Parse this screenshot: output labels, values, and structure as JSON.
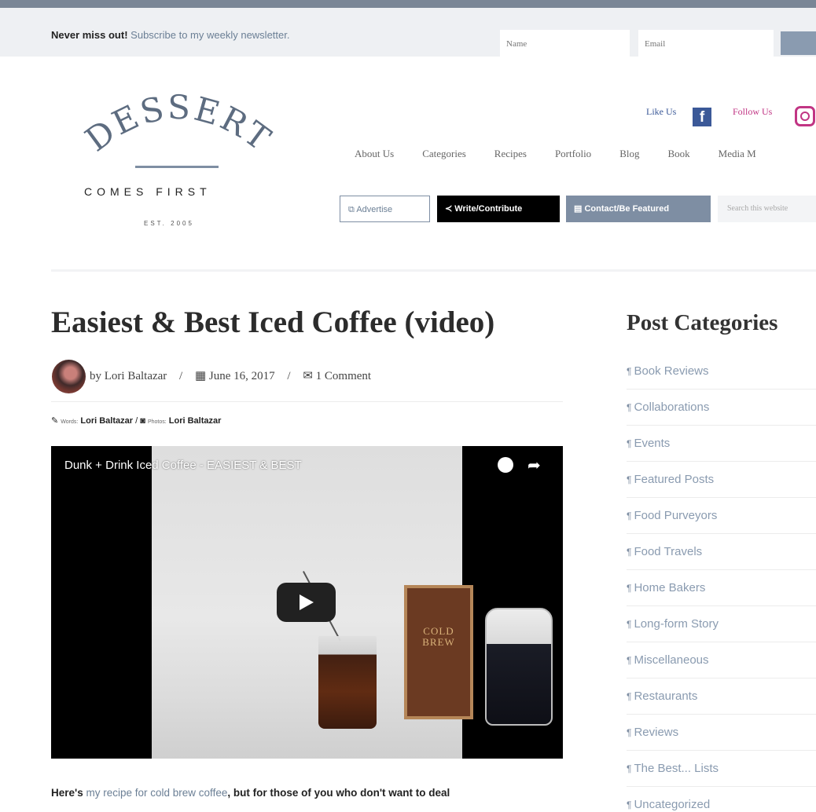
{
  "newsletter": {
    "lead": "Never miss out!",
    "cta": "Subscribe to my weekly newsletter.",
    "name_placeholder": "Name",
    "email_placeholder": "Email"
  },
  "logo": {
    "word": "DESSERT",
    "tagline": "COMES FIRST",
    "est": "EST. 2005"
  },
  "social": {
    "like_label": "Like Us",
    "follow_label": "Follow Us"
  },
  "nav": {
    "items": [
      "About Us",
      "Categories",
      "Recipes",
      "Portfolio",
      "Blog",
      "Book",
      "Media M"
    ]
  },
  "actions": {
    "advertise": "Advertise",
    "write": "Write/Contribute",
    "contact": "Contact/Be Featured",
    "search_placeholder": "Search this website"
  },
  "post": {
    "title": "Easiest & Best Iced Coffee (video)",
    "author": "by Lori Baltazar",
    "date": "June 16, 2017",
    "comments": "1 Comment",
    "words_label": "Words:",
    "words_author": "Lori Baltazar",
    "photos_label": "Photos:",
    "photos_author": "Lori Baltazar",
    "video_title": "Dunk + Drink Iced Coffee - EASIEST & BEST",
    "package_label_1": "COLD",
    "package_label_2": "BREW",
    "para_start": "Here's ",
    "para_link": "my recipe for cold brew coffee",
    "para_rest": ", but for those of you who don't want to deal"
  },
  "sidebar": {
    "title": "Post Categories",
    "categories": [
      "Book Reviews",
      "Collaborations",
      "Events",
      "Featured Posts",
      "Food Purveyors",
      "Food Travels",
      "Home Bakers",
      "Long-form Story",
      "Miscellaneous",
      "Restaurants",
      "Reviews",
      "The Best... Lists",
      "Uncategorized"
    ]
  },
  "colors": {
    "accent": "#7e8ea3",
    "facebook": "#3b5998",
    "instagram": "#c13584"
  }
}
